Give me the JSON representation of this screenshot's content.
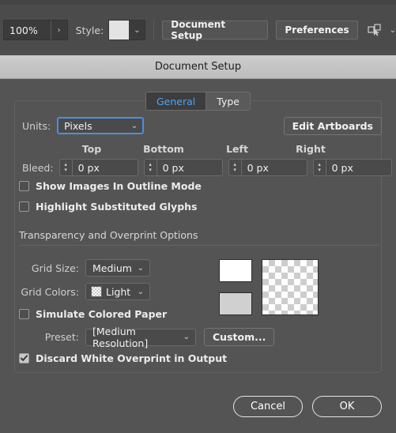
{
  "toolbar": {
    "zoom_value": "100%",
    "zoom_arrow_glyph": "›",
    "style_label": "Style:",
    "style_swatch_color": "#e3e3e3",
    "document_setup_label": "Document Setup",
    "preferences_label": "Preferences",
    "caret_glyph": "⌄"
  },
  "dialog": {
    "title": "Document Setup",
    "tabs": [
      {
        "label": "General",
        "active": true
      },
      {
        "label": "Type",
        "active": false
      }
    ],
    "units": {
      "label": "Units:",
      "value": "Pixels",
      "caret_glyph": "⌄"
    },
    "edit_artboards_label": "Edit Artboards",
    "bleed": {
      "label": "Bleed:",
      "columns": [
        "Top",
        "Bottom",
        "Left",
        "Right"
      ],
      "values": [
        "0 px",
        "0 px",
        "0 px",
        "0 px"
      ],
      "link_icon": "chain-link-icon",
      "stepper_up": "▴",
      "stepper_down": "▾"
    },
    "checkboxes": [
      {
        "label": "Show Images In Outline Mode",
        "checked": false
      },
      {
        "label": "Highlight Substituted Glyphs",
        "checked": false
      }
    ],
    "transparency": {
      "section_title": "Transparency and Overprint Options",
      "grid_size": {
        "label": "Grid Size:",
        "value": "Medium",
        "caret_glyph": "⌄"
      },
      "grid_colors": {
        "label": "Grid Colors:",
        "value": "Light",
        "caret_glyph": "⌄"
      },
      "simulate_colored_paper": {
        "label": "Simulate Colored Paper",
        "checked": false
      },
      "swatch_top_color": "#ffffff",
      "swatch_bottom_color": "#d0d0d0",
      "preset": {
        "label": "Preset:",
        "value": "[Medium Resolution]",
        "caret_glyph": "⌄"
      },
      "custom_label": "Custom...",
      "discard_white_overprint": {
        "label": "Discard White Overprint in Output",
        "checked": true
      }
    },
    "footer": {
      "cancel_label": "Cancel",
      "ok_label": "OK"
    }
  },
  "colors": {
    "app_background": "#4b4b4b",
    "dialog_background": "#545454",
    "titlebar": "#c4c4c4",
    "accent_blue": "#4fa3f7",
    "focus_blue": "#4a90e2",
    "text": "#eeeeee"
  }
}
